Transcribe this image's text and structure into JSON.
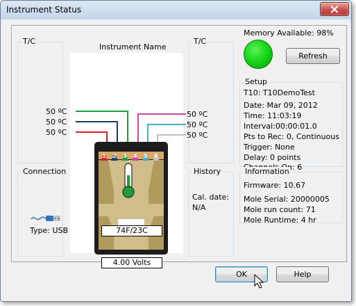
{
  "window": {
    "title": "Instrument Status"
  },
  "status": {
    "memory_available": "Memory Available: 98%",
    "led_color": "#18d818"
  },
  "buttons": {
    "refresh": "Refresh",
    "ok": "OK",
    "help": "Help"
  },
  "left_tc": {
    "label": "T/C",
    "readings": [
      "50 ºC",
      "50 ºC",
      "50 ºC"
    ]
  },
  "right_tc": {
    "label": "T/C",
    "readings": [
      "50 ºC",
      "50 ºC",
      "50 ºC"
    ]
  },
  "instrument": {
    "label": "Instrument Name",
    "channels": [
      "1",
      "2",
      "3",
      "4",
      "5",
      "6"
    ],
    "channel_colors": [
      "#e02020",
      "#1a3d6e",
      "#1e9e3a",
      "#cc44aa",
      "#45b0c8",
      "#c0c0c0"
    ],
    "temperature": "74F/23C",
    "voltage": "4.00 Volts"
  },
  "connection": {
    "label": "Connection",
    "type": "Type: USB"
  },
  "history": {
    "label": "History",
    "cal_date_label": "Cal. date:",
    "cal_date_value": "N/A"
  },
  "setup": {
    "label": "Setup",
    "lines": [
      "T10: T10DemoTest",
      "Date: Mar 09, 2012",
      "Time: 11:03:19",
      "Interval:00:00:01.0",
      "Pts to Rec: 0, Continuous",
      "Trigger: None",
      "Delay: 0 points",
      "Channels On: 6"
    ]
  },
  "information": {
    "label": "Information",
    "firmware": "Firmware: 10.67",
    "lines": [
      "Mole Serial: 20000005",
      "Mole run count: 71",
      "Mole Runtime: 4 hr"
    ]
  }
}
